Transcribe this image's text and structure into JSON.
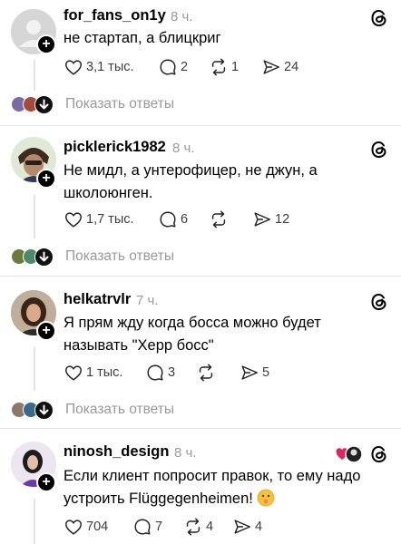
{
  "ui": {
    "show_replies": "Показать ответы",
    "accent_color": "#000000",
    "muted_color": "#999999"
  },
  "posts": [
    {
      "username": "for_fans_on1y",
      "time": "8 ч.",
      "text": "не стартап, а блицкриг",
      "likes": "3,1 тыс.",
      "comments": "2",
      "reposts": "1",
      "shares": "24"
    },
    {
      "username": "picklerick1982",
      "time": "8 ч.",
      "text": "Не мидл, а унтерофицер, не джун, а школоюнген.",
      "likes": "1,7 тыс.",
      "comments": "6",
      "reposts": "",
      "shares": "12"
    },
    {
      "username": "helkatrvlr",
      "time": "7 ч.",
      "text": "Я прям жду когда босса можно будет называть \"Херр босс\"",
      "likes": "1 тыс.",
      "comments": "3",
      "reposts": "",
      "shares": "5"
    },
    {
      "username": "ninosh_design",
      "time": "8 ч.",
      "text": "Если клиент попросит правок, то ему надо устроить Flüggegenheimen!",
      "likes": "704",
      "comments": "7",
      "reposts": "4",
      "shares": "4"
    }
  ]
}
